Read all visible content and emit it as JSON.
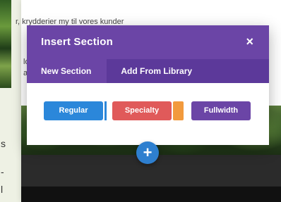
{
  "background": {
    "line1": "r, krydderier my til vores kunder",
    "line2a": "lo",
    "line2b": "a",
    "left_chars": [
      "s",
      "-",
      "l"
    ]
  },
  "modal": {
    "title": "Insert Section",
    "close_symbol": "×",
    "tabs": [
      {
        "label": "New Section",
        "active": true
      },
      {
        "label": "Add From Library",
        "active": false
      }
    ],
    "buttons": {
      "regular": "Regular",
      "specialty": "Specialty",
      "fullwidth": "Fullwidth"
    }
  },
  "add_button": {
    "symbol": "+"
  },
  "colors": {
    "header": "#6b45a6",
    "tabs": "#5c399a",
    "regular": "#2b87da",
    "specialty": "#e05a5a",
    "specialty_accent": "#f29a3d",
    "fullwidth": "#6b45a6",
    "add_button": "#2e7fcf"
  }
}
